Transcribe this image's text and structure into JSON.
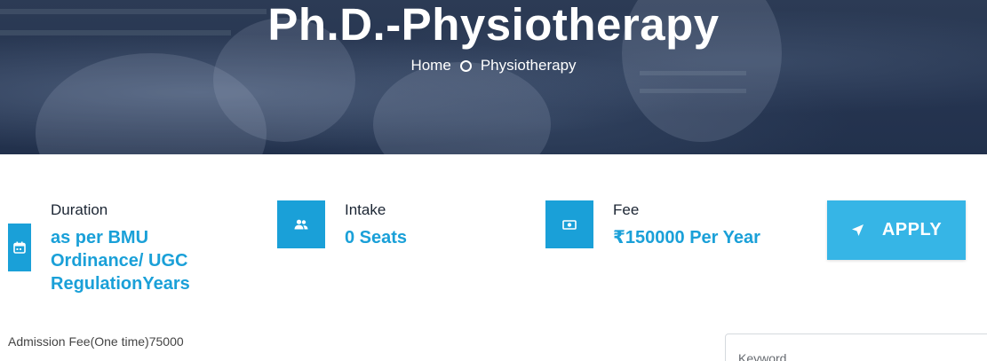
{
  "hero": {
    "title": "Ph.D.-Physiotherapy",
    "breadcrumb": {
      "home": "Home",
      "current": "Physiotherapy"
    }
  },
  "info": {
    "duration": {
      "label": "Duration",
      "value_lines": [
        "as per BMU",
        "Ordinance/ UGC",
        "RegulationYears"
      ],
      "icon": "calendar-icon"
    },
    "intake": {
      "label": "Intake",
      "value": "0 Seats",
      "icon": "users-icon"
    },
    "fee": {
      "label": "Fee",
      "value": "₹150000 Per Year",
      "icon": "money-icon"
    }
  },
  "apply_button": {
    "label": "APPLY",
    "icon": "send-icon"
  },
  "admission_fee": "Admission Fee(One time)75000",
  "search": {
    "placeholder": "Keyword"
  },
  "colors": {
    "accent": "#1aa0d8",
    "apply": "#36b5e6",
    "hero_bg": "#283a56"
  }
}
